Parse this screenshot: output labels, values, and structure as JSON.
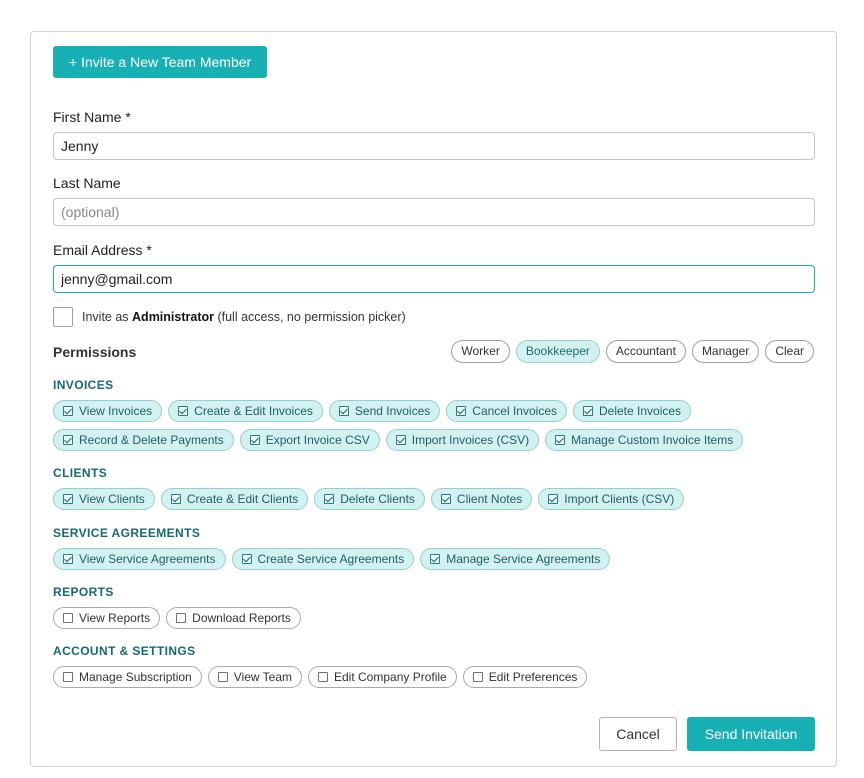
{
  "invite_button_label": "+ Invite a New Team Member",
  "fields": {
    "first_name": {
      "label": "First Name *",
      "value": "Jenny",
      "placeholder": ""
    },
    "last_name": {
      "label": "Last Name",
      "value": "",
      "placeholder": "(optional)"
    },
    "email": {
      "label": "Email Address *",
      "value": "jenny@gmail.com",
      "placeholder": ""
    }
  },
  "admin": {
    "prefix": "Invite as ",
    "bold": "Administrator",
    "suffix": " (full access, no permission picker)",
    "checked": false
  },
  "permissions_title": "Permissions",
  "presets": [
    {
      "label": "Worker",
      "active": false
    },
    {
      "label": "Bookkeeper",
      "active": true
    },
    {
      "label": "Accountant",
      "active": false
    },
    {
      "label": "Manager",
      "active": false
    },
    {
      "label": "Clear",
      "active": false
    }
  ],
  "sections": {
    "invoices": {
      "title": "INVOICES",
      "items": [
        {
          "label": "View Invoices",
          "checked": true
        },
        {
          "label": "Create & Edit Invoices",
          "checked": true
        },
        {
          "label": "Send Invoices",
          "checked": true
        },
        {
          "label": "Cancel Invoices",
          "checked": true
        },
        {
          "label": "Delete Invoices",
          "checked": true
        },
        {
          "label": "Record & Delete Payments",
          "checked": true
        },
        {
          "label": "Export Invoice CSV",
          "checked": true
        },
        {
          "label": "Import Invoices (CSV)",
          "checked": true
        },
        {
          "label": "Manage Custom Invoice Items",
          "checked": true
        }
      ]
    },
    "clients": {
      "title": "CLIENTS",
      "items": [
        {
          "label": "View Clients",
          "checked": true
        },
        {
          "label": "Create & Edit Clients",
          "checked": true
        },
        {
          "label": "Delete Clients",
          "checked": true
        },
        {
          "label": "Client Notes",
          "checked": true
        },
        {
          "label": "Import Clients (CSV)",
          "checked": true
        }
      ]
    },
    "service_agreements": {
      "title": "SERVICE AGREEMENTS",
      "items": [
        {
          "label": "View Service Agreements",
          "checked": true
        },
        {
          "label": "Create Service Agreements",
          "checked": true
        },
        {
          "label": "Manage Service Agreements",
          "checked": true
        }
      ]
    },
    "reports": {
      "title": "REPORTS",
      "items": [
        {
          "label": "View Reports",
          "checked": false
        },
        {
          "label": "Download Reports",
          "checked": false
        }
      ]
    },
    "account_settings": {
      "title": "ACCOUNT & SETTINGS",
      "items": [
        {
          "label": "Manage Subscription",
          "checked": false
        },
        {
          "label": "View Team",
          "checked": false
        },
        {
          "label": "Edit Company Profile",
          "checked": false
        },
        {
          "label": "Edit Preferences",
          "checked": false
        }
      ]
    }
  },
  "footer": {
    "cancel_label": "Cancel",
    "send_label": "Send Invitation"
  },
  "colors": {
    "accent": "#17b0b4",
    "chip_active_bg": "#d4f1f2",
    "section_title": "#156a6e"
  }
}
